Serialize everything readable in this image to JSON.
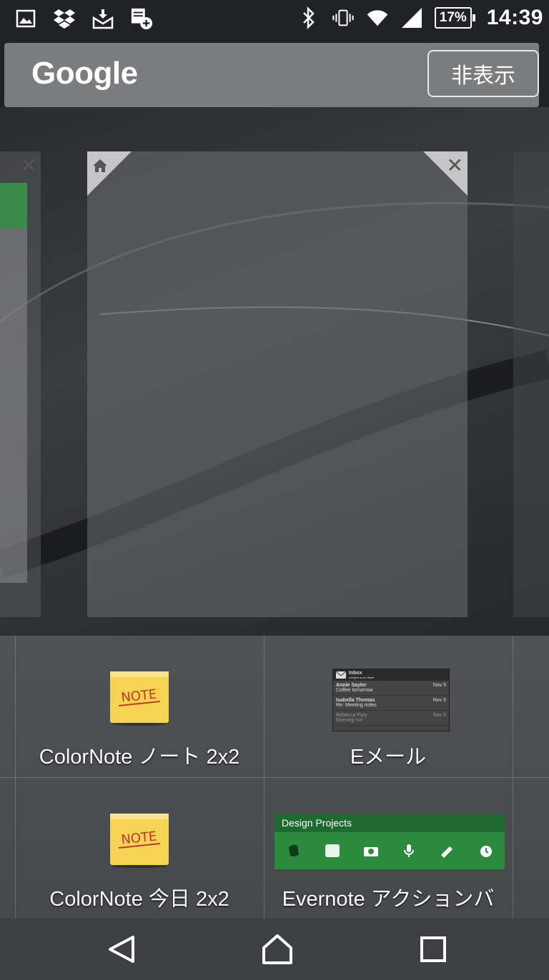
{
  "status_bar": {
    "icons_left": [
      "image-icon",
      "dropbox-icon",
      "mail-download-icon",
      "notes-add-icon"
    ],
    "icons_right": [
      "bluetooth-icon",
      "vibrate-icon",
      "wifi-icon",
      "signal-icon"
    ],
    "battery_percent": "17%",
    "battery_level": 0.17,
    "time": "14:39"
  },
  "search": {
    "logo": "Google",
    "hide_label": "非表示"
  },
  "widgets": [
    {
      "label": "ColorNote ノート 2x2",
      "icon": "note-icon",
      "icon_text": "NOTE"
    },
    {
      "label": "Eメール",
      "icon": "email-preview"
    },
    {
      "label": "ColorNote 今日 2x2",
      "icon": "note-icon",
      "icon_text": "NOTE"
    },
    {
      "label": "Evernote アクションバ",
      "icon": "evernote-widget"
    }
  ],
  "email_preview": {
    "title": "Inbox",
    "subtitle": "cell@bma.me.fakeit",
    "rows": [
      {
        "from": "Annie Saylor",
        "subject": "Coffee tomorrow",
        "date": "Nov 5"
      },
      {
        "from": "Isabella Thomas",
        "subject": "Re: Meeting notes",
        "date": "Nov 5"
      },
      {
        "from": "Rebecca Fury",
        "subject": "Morning run",
        "date": "Nov 5"
      }
    ]
  },
  "evernote": {
    "title": "Design Projects"
  },
  "nav": [
    "back-icon",
    "home-icon",
    "recents-icon"
  ],
  "colors": {
    "evernote_green": "#2c8a3f",
    "note_yellow": "#f4d452"
  }
}
